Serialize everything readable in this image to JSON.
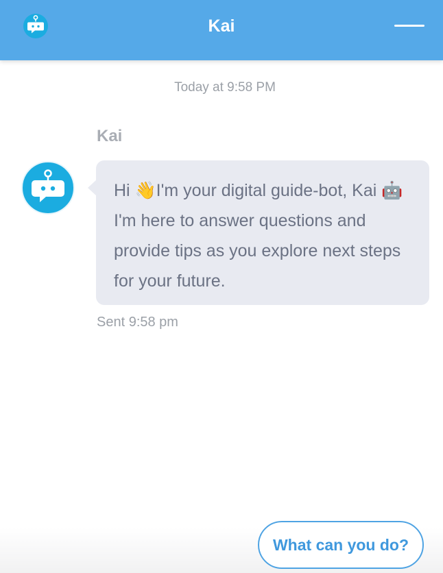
{
  "header": {
    "title": "Kai",
    "logo_icon": "chatbot-icon",
    "minimize_icon": "minimize-icon"
  },
  "conversation": {
    "timestamp": "Today at 9:58 PM",
    "messages": [
      {
        "sender": "Kai",
        "avatar_icon": "chatbot-icon",
        "text": "Hi 👋I'm your digital guide-bot, Kai 🤖I'm here to answer questions and provide tips as you explore next steps for your future.",
        "sent_label": "Sent 9:58 pm"
      }
    ]
  },
  "quick_replies": [
    {
      "label": "What can you do?"
    }
  ],
  "colors": {
    "header_bg": "#55a9e8",
    "avatar_bg": "#1bace0",
    "bubble_bg": "#e8eaf1",
    "accent": "#4ea3e3"
  }
}
